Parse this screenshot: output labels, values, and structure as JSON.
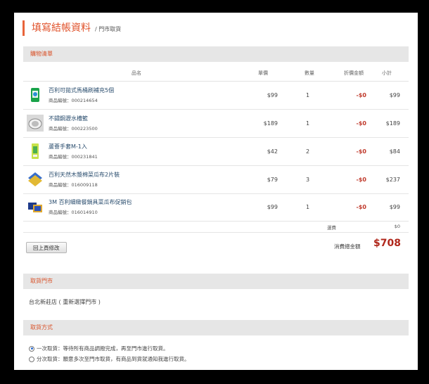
{
  "page": {
    "title": "填寫結帳資料",
    "subtitle": "/ 門市取貨"
  },
  "cart": {
    "section_title": "購物清單",
    "columns": {
      "name": "品名",
      "unit_price": "單價",
      "qty": "數量",
      "discount": "折價金額",
      "subtotal": "小計"
    },
    "items": [
      {
        "name": "百利可拋式馬桶刷補充5個",
        "code": "商品編號：000214654",
        "price": "$99",
        "qty": "1",
        "discount": "-$0",
        "subtotal": "$99",
        "icon": "toilet-brush-refill-product-icon"
      },
      {
        "name": "不鏽鋼瀝水槽籃",
        "code": "商品編號：000223500",
        "price": "$189",
        "qty": "1",
        "discount": "-$0",
        "subtotal": "$189",
        "icon": "sink-basket-product-icon"
      },
      {
        "name": "蘆薈手套M-1入",
        "code": "商品編號：000231841",
        "price": "$42",
        "qty": "2",
        "discount": "-$0",
        "subtotal": "$84",
        "icon": "gloves-product-icon"
      },
      {
        "name": "百利天然木漿棉菜瓜布2片裝",
        "code": "商品編號：016009118",
        "price": "$79",
        "qty": "3",
        "discount": "-$0",
        "subtotal": "$237",
        "icon": "sponge-product-icon"
      },
      {
        "name": "3M 百利細緻餐鍋具菜瓜布促銷包",
        "code": "商品編號：016014910",
        "price": "$99",
        "qty": "1",
        "discount": "-$0",
        "subtotal": "$99",
        "icon": "scrub-pad-product-icon"
      }
    ],
    "shipping_label": "運費",
    "shipping_value": "$0",
    "back_button": "回上頁修改",
    "total_label": "消費總金額",
    "total_value": "$708"
  },
  "pickup_store": {
    "section_title": "取貨門市",
    "store_name": "台北新莊店",
    "reselect_link": "( 重新選擇門市 )"
  },
  "pickup_method": {
    "section_title": "取貨方式",
    "options": [
      {
        "label": "一次取貨：等待所有商品調撥完成，再至門市進行取貨。",
        "selected": true
      },
      {
        "label": "分次取貨：願意多次至門市取貨，有商品到貨就通知我進行取貨。",
        "selected": false
      }
    ]
  },
  "colors": {
    "accent": "#e0522b",
    "price_total": "#b0271b",
    "discount": "#c0392b",
    "radio_selected": "#2a6bd1"
  }
}
